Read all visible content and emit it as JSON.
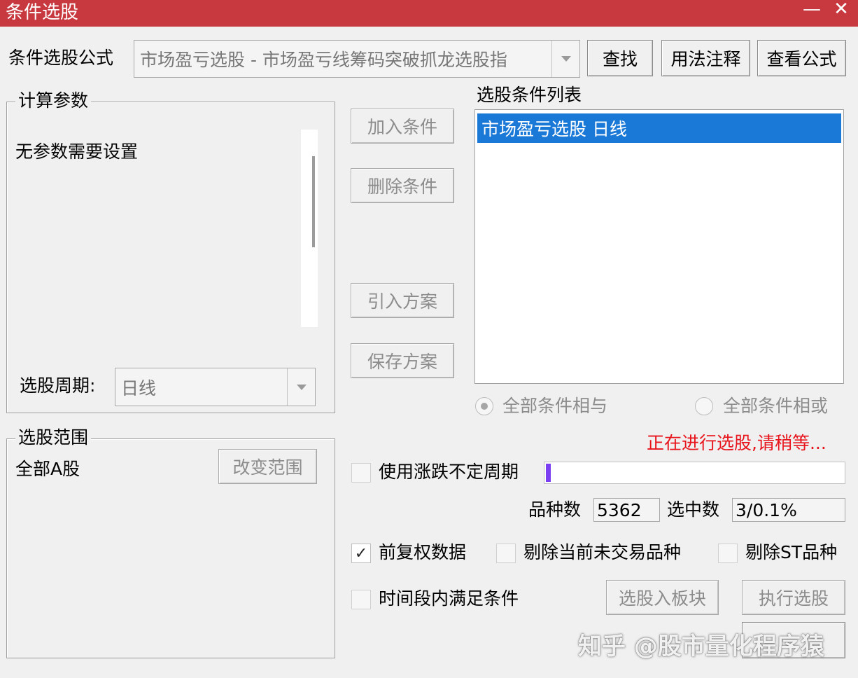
{
  "window": {
    "title": "条件选股",
    "minimize_glyph": "—",
    "close_glyph": "✕"
  },
  "formula": {
    "label": "条件选股公式",
    "selected": "市场盈亏选股  -  市场盈亏线筹码突破抓龙选股指",
    "find_button": "查找",
    "usage_button": "用法注释",
    "view_button": "查看公式"
  },
  "params": {
    "legend": "计算参数",
    "message": "无参数需要设置",
    "period_label": "选股周期:",
    "period_value": "日线"
  },
  "middle_buttons": {
    "add": "加入条件",
    "delete": "删除条件",
    "import": "引入方案",
    "save": "保存方案"
  },
  "conditions": {
    "label": "选股条件列表",
    "items": [
      "市场盈亏选股  日线"
    ],
    "and_label": "全部条件相与",
    "or_label": "全部条件相或"
  },
  "status": {
    "message": "正在进行选股,请稍等...",
    "color": "#e8141b"
  },
  "options": {
    "variable_period": "使用涨跌不定周期",
    "pre_adjusted": "前复权数据",
    "exclude_untraded": "剔除当前未交易品种",
    "exclude_st": "剔除ST品种",
    "time_range": "时间段内满足条件"
  },
  "progress": {
    "fraction": 0.0163,
    "color": "#7b3ff2"
  },
  "stats": {
    "count_label": "品种数",
    "count_value": "5362",
    "selected_label": "选中数",
    "selected_value": "3/0.1%"
  },
  "scope": {
    "legend": "选股范围",
    "value": "全部A股",
    "change_button": "改变范围"
  },
  "actions": {
    "to_block": "选股入板块",
    "execute": "执行选股"
  },
  "watermark": "知乎 @股市量化程序猿"
}
